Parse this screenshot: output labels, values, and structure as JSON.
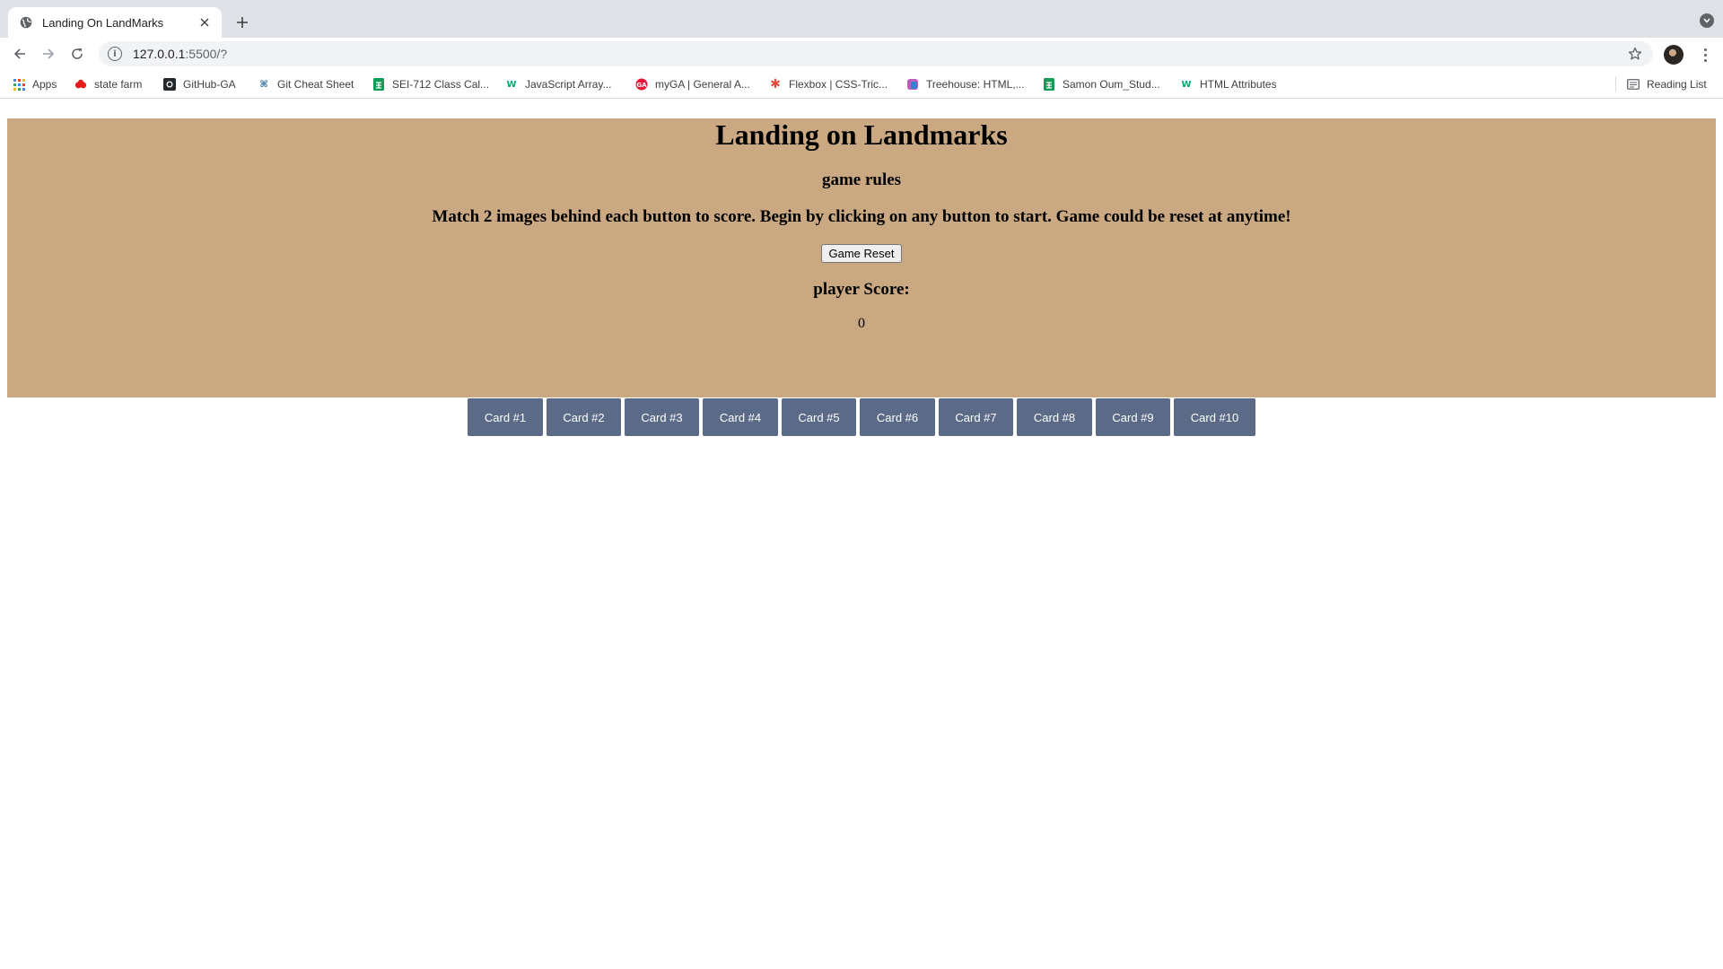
{
  "browser": {
    "tab_title": "Landing On LandMarks",
    "url_host": "127.0.0.1",
    "url_rest": ":5500/?",
    "bookmarks": [
      {
        "label": "Apps",
        "icon": "apps-grid-icon"
      },
      {
        "label": "state farm",
        "icon": "state-farm-icon"
      },
      {
        "label": "GitHub-GA",
        "icon": "github-icon"
      },
      {
        "label": "Git Cheat Sheet",
        "icon": "git-icon"
      },
      {
        "label": "SEI-712 Class Cal...",
        "icon": "sheets-icon"
      },
      {
        "label": "JavaScript Array...",
        "icon": "w3schools-icon"
      },
      {
        "label": "myGA | General A...",
        "icon": "ga-icon"
      },
      {
        "label": "Flexbox | CSS-Tric...",
        "icon": "css-tricks-icon"
      },
      {
        "label": "Treehouse: HTML,...",
        "icon": "treehouse-icon"
      },
      {
        "label": "Samon Oum_Stud...",
        "icon": "sheets-icon"
      },
      {
        "label": "HTML Attributes",
        "icon": "w3schools-icon"
      }
    ],
    "reading_list": "Reading List"
  },
  "game": {
    "title": "Landing on Landmarks",
    "rules_heading": "game rules",
    "rules_text": "Match 2 images behind each button to score. Begin by clicking on any button to start. Game could be reset at anytime!",
    "reset_label": "Game Reset",
    "score_label": "player Score:",
    "score_value": "0",
    "cards": [
      "Card #1",
      "Card #2",
      "Card #3",
      "Card #4",
      "Card #5",
      "Card #6",
      "Card #7",
      "Card #8",
      "Card #9",
      "Card #10"
    ]
  },
  "colors": {
    "hero_background": "#caa982",
    "card_button": "#5a6a87"
  }
}
